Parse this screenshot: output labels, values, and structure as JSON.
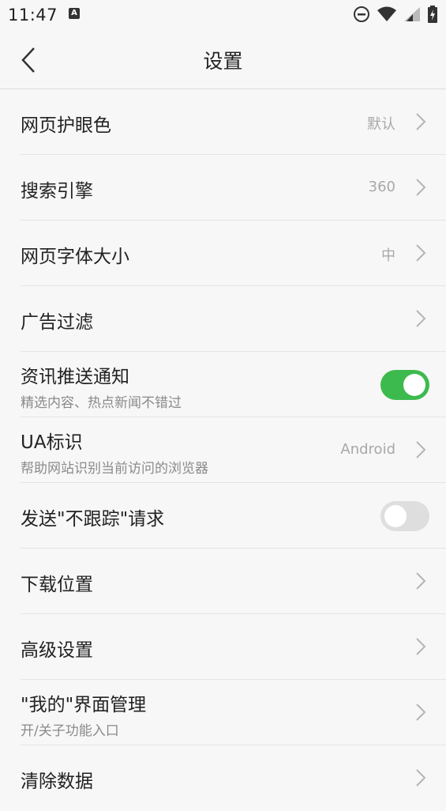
{
  "status_bar": {
    "time": "11:47",
    "notification_letter": "A"
  },
  "header": {
    "title": "设置"
  },
  "settings": [
    {
      "label": "网页护眼色",
      "value": "默认"
    },
    {
      "label": "搜索引擎",
      "value": "360"
    },
    {
      "label": "网页字体大小",
      "value": "中"
    },
    {
      "label": "广告过滤"
    },
    {
      "label": "资讯推送通知",
      "sub": "精选内容、热点新闻不错过",
      "toggle": true
    },
    {
      "label": "UA标识",
      "sub": "帮助网站识别当前访问的浏览器",
      "value": "Android"
    },
    {
      "label": "发送\"不跟踪\"请求",
      "toggle": false
    },
    {
      "label": "下载位置"
    },
    {
      "label": "高级设置"
    },
    {
      "label": "\"我的\"界面管理",
      "sub": "开/关子功能入口"
    },
    {
      "label": "清除数据"
    }
  ],
  "colors": {
    "toggle_on": "#3dba4e",
    "toggle_off": "#dedede"
  }
}
